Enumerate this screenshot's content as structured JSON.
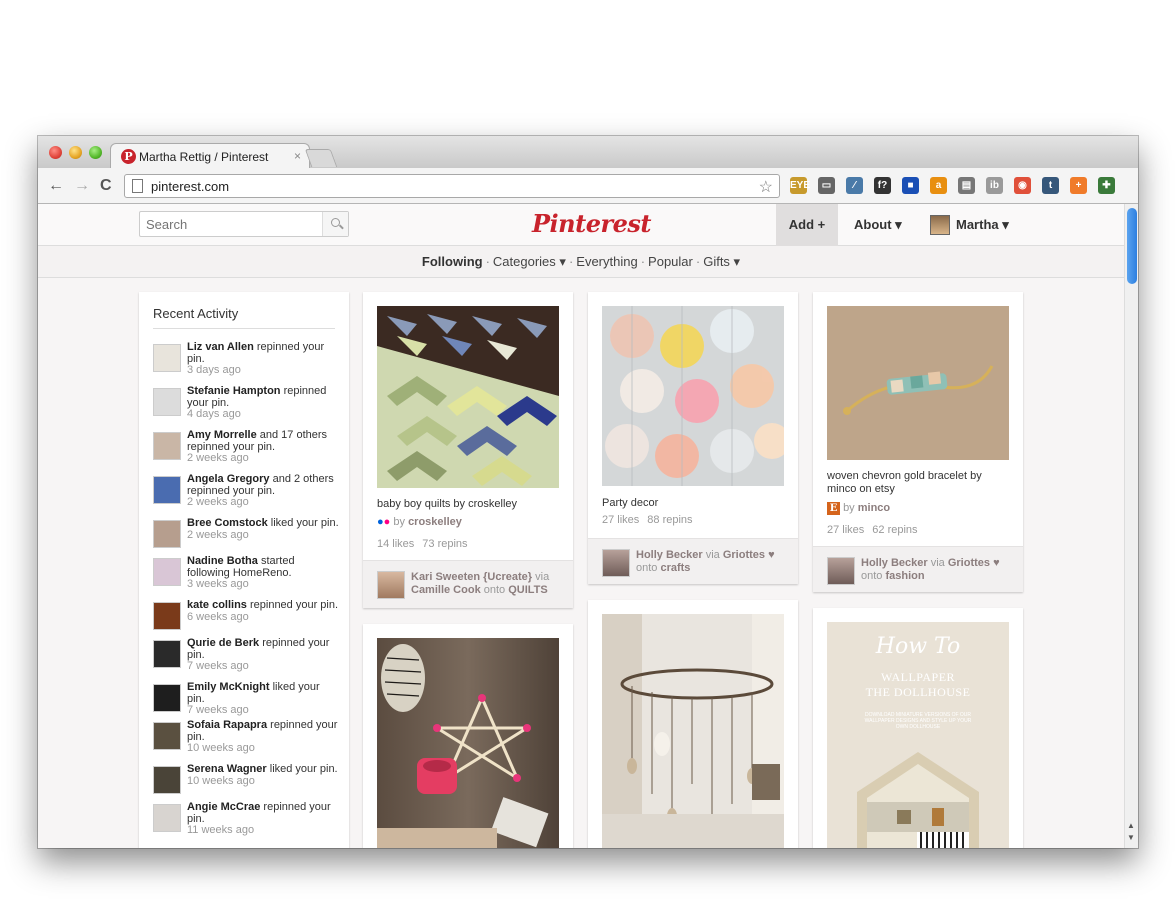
{
  "browser": {
    "tab_title": "Martha Rettig / Pinterest",
    "tab_close": "×",
    "url": "pinterest.com",
    "nav": {
      "back": "←",
      "forward": "→",
      "reload": "C"
    },
    "star": "☆",
    "extensions": [
      {
        "label": "EYE",
        "color": "#c79a2c"
      },
      {
        "label": "▭",
        "color": "#666666"
      },
      {
        "label": "⁄",
        "color": "#4a7aa8"
      },
      {
        "label": "f?",
        "color": "#333333"
      },
      {
        "label": "■",
        "color": "#1a4fb5"
      },
      {
        "label": "a",
        "color": "#e88f10"
      },
      {
        "label": "▤",
        "color": "#777777"
      },
      {
        "label": "ib",
        "color": "#9a9a9a"
      },
      {
        "label": "◉",
        "color": "#e0503a"
      },
      {
        "label": "t",
        "color": "#36577a"
      },
      {
        "label": "+",
        "color": "#f07b2a"
      },
      {
        "label": "✚",
        "color": "#3a7a3a"
      }
    ]
  },
  "header": {
    "search_placeholder": "Search",
    "logo": "Pinterest",
    "add_label": "Add +",
    "about_label": "About ▾",
    "user_name": "Martha ▾"
  },
  "subnav": {
    "following": "Following",
    "categories": "Categories ▾",
    "everything": "Everything",
    "popular": "Popular",
    "gifts": "Gifts ▾",
    "dot": "·"
  },
  "activity": {
    "title": "Recent Activity",
    "items": [
      {
        "name": "Liz van Allen",
        "action": " repinned your pin.",
        "time": "3 days ago"
      },
      {
        "name": "Stefanie Hampton",
        "action": " repinned your pin.",
        "time": "4 days ago"
      },
      {
        "name": "Amy Morrelle",
        "action": " and 17 others repinned your pin.",
        "time": "2 weeks ago"
      },
      {
        "name": "Angela Gregory",
        "action": " and 2 others repinned your pin.",
        "time": "2 weeks ago"
      },
      {
        "name": "Bree Comstock",
        "action": " liked your pin.",
        "time": "2 weeks ago"
      },
      {
        "name": "Nadine Botha",
        "action": " started following HomeReno.",
        "time": "3 weeks ago"
      },
      {
        "name": "kate collins",
        "action": " repinned your pin.",
        "time": "6 weeks ago"
      },
      {
        "name": "Qurie de Berk",
        "action": " repinned your pin.",
        "time": "7 weeks ago"
      },
      {
        "name": "Emily McKnight",
        "action": " liked your pin.",
        "time": "7 weeks ago"
      },
      {
        "name": "Sofaia Rapapra",
        "action": " repinned your pin.",
        "time": "10 weeks ago"
      },
      {
        "name": "Serena Wagner",
        "action": " liked your pin.",
        "time": "10 weeks ago"
      },
      {
        "name": "Angie McCrae",
        "action": " repinned your pin.",
        "time": "11 weeks ago"
      }
    ]
  },
  "pins": {
    "quilts": {
      "description": "baby boy quilts by croskelley",
      "source_prefix": "by ",
      "source_name": "croskelley",
      "likes": "14 likes",
      "repins": "73 repins",
      "via_user": "Kari Sweeten {Ucreate}",
      "via_word": " via ",
      "via_from": "Camille Cook",
      "onto_word": " onto ",
      "board": "QUILTS"
    },
    "party": {
      "description": "Party decor",
      "likes": "27 likes",
      "repins": "88 repins",
      "via_user": "Holly Becker",
      "via_word": " via ",
      "via_from": "Griottes ♥",
      "onto_word": "onto ",
      "board": "crafts"
    },
    "bracelet": {
      "description": "woven chevron gold bracelet by minco on etsy",
      "source_prefix": "by ",
      "source_name": "minco",
      "likes": "27 likes",
      "repins": "62 repins",
      "via_user": "Holly Becker",
      "via_word": " via ",
      "via_from": "Griottes ♥",
      "onto_word": "onto ",
      "board": "fashion"
    },
    "wallpaper_book": {
      "title_script": "How To",
      "title_line1": "WALLPAPER",
      "title_line2": "THE DOLLHOUSE",
      "subtitle": "DOWNLOAD MINIATURE VERSIONS OF OUR WALLPAPER DESIGNS AND STYLE UP YOUR OWN DOLLHOUSE"
    }
  },
  "colors": {
    "brand_red": "#c8232c",
    "page_bg": "#f7f5f5"
  }
}
